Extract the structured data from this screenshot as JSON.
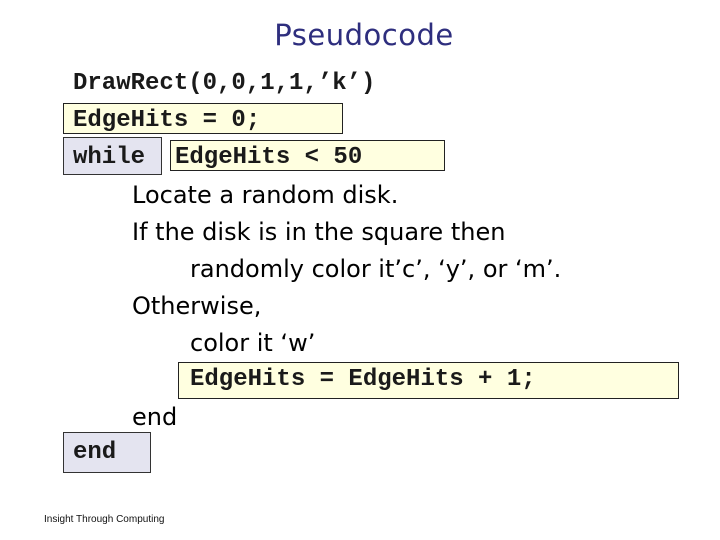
{
  "slide": {
    "title": "Pseudocode",
    "lines": {
      "drawrect": "DrawRect(0,0,1,1,’k’)",
      "init": "EdgeHits = 0;",
      "while_kw": "while",
      "while_cond": "EdgeHits < 50",
      "locate": "Locate a random disk.",
      "if_line": "If the disk is in the square then",
      "color_random": "randomly color it’c’, ‘y’, or ‘m’.",
      "otherwise": "Otherwise,",
      "color_w": "color it ‘w’",
      "increment": "EdgeHits = EdgeHits + 1;",
      "inner_end": "end",
      "outer_end": "end"
    },
    "footer": "Insight Through Computing",
    "colors": {
      "title": "#2e2e7e",
      "highlight_yellow": "#ffffe0",
      "highlight_lavender": "#e4e4f0"
    }
  }
}
